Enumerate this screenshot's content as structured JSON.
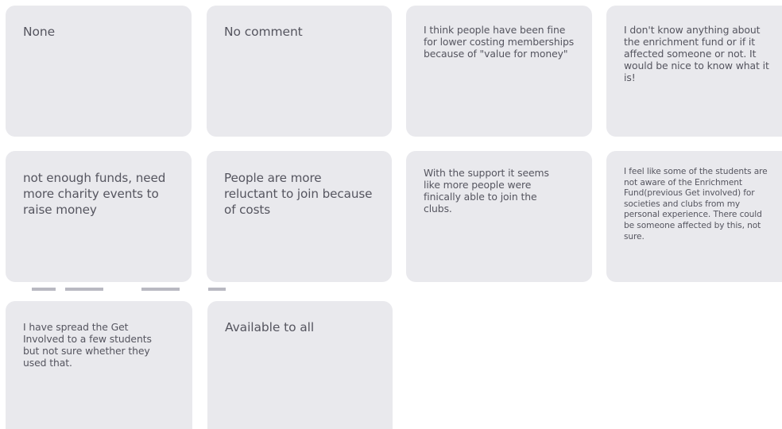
{
  "board": {
    "notes": [
      {
        "text": "None"
      },
      {
        "text": "No comment"
      },
      {
        "text": "I think people have been fine for lower costing memberships because of \"value for money\""
      },
      {
        "text": "I don't know anything about the enrichment fund or if it affected someone or not. It would be nice to know what it is!"
      },
      {
        "text": "not enough funds, need more charity events to raise money"
      },
      {
        "text": "People are more reluctant to join because of costs"
      },
      {
        "text": "With the support it seems like more people were finically able to join the clubs."
      },
      {
        "text": "I feel like some of the students are not aware of the Enrichment Fund(previous Get involved) for societies and clubs from my personal experience. There could be someone affected by this, not sure."
      },
      {
        "text": "I have spread the Get Involved to a few students but not sure whether they used that."
      },
      {
        "text": "Available to all"
      }
    ]
  },
  "colors": {
    "card_background": "#e9e9ed",
    "text": "#55555f",
    "page_background": "#ffffff"
  }
}
